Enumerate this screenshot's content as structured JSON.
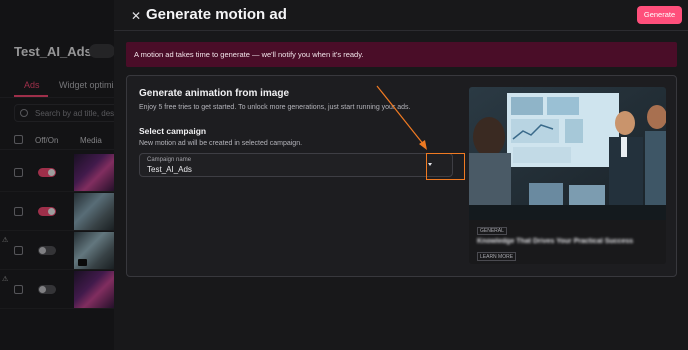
{
  "background_app": {
    "title": "Test_AI_Ads",
    "tabs": [
      "Ads",
      "Widget optimiz"
    ],
    "search_placeholder": "Search by ad title, descripti",
    "columns": [
      "Off/On",
      "Media"
    ],
    "rows": [
      {
        "toggle": "on"
      },
      {
        "toggle": "on"
      },
      {
        "toggle": "off"
      },
      {
        "toggle": "off"
      }
    ]
  },
  "drawer": {
    "title": "Generate motion ad",
    "generate_label": "Generate",
    "banner": "A motion ad takes time to generate — we'll notify you when it's ready.",
    "section_title": "Generate animation from image",
    "section_subtitle": "Enjoy 5 free tries to get started. To unlock more generations, just start running your ads.",
    "select_title": "Select campaign",
    "select_subtitle": "New motion ad will be created in selected campaign.",
    "campaign_field": {
      "label": "Campaign name",
      "value": "Test_AI_Ads"
    },
    "preview": {
      "tag": "GENERAL",
      "headline": "Knowledge That Drives Your Practical Success",
      "cta": "LEARN MORE"
    }
  },
  "colors": {
    "accent": "#ff4f7b",
    "banner_bg": "#4a0d28",
    "highlight": "#f07a22"
  }
}
